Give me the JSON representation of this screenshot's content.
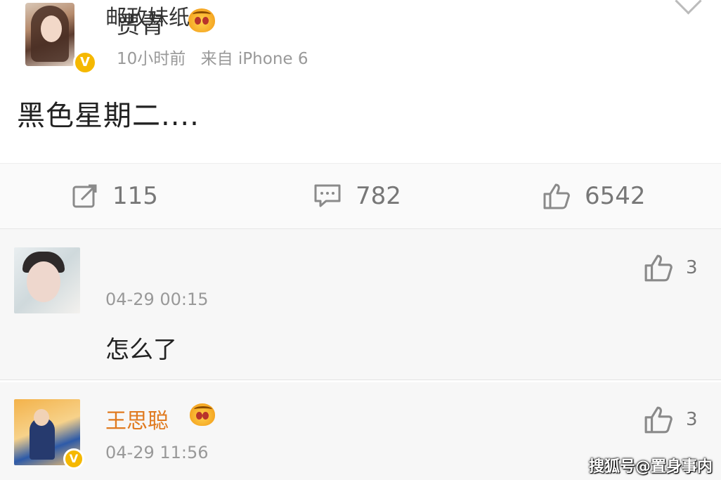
{
  "post": {
    "author": "贾青",
    "time": "10小时前",
    "source": "来自 iPhone 6",
    "verified_badge": "V",
    "content": "黑色星期二....",
    "icons": {
      "crown": "vip-crown-icon",
      "expand": "chevron-down-icon"
    }
  },
  "actions": {
    "repost_count": "115",
    "comment_count": "782",
    "like_count": "6542"
  },
  "comments": [
    {
      "name": "邮政妹纸",
      "time": "04-29 00:15",
      "text": "怎么了",
      "likes": "3"
    },
    {
      "name": "王思聪",
      "time": "04-29 11:56",
      "verified_badge": "V",
      "likes": "3"
    }
  ],
  "watermark": "搜狐号@置身事内",
  "colors": {
    "verified": "#f5b800",
    "vip_name": "#e07a1f",
    "muted": "#999999",
    "divider": "#e6e6e6"
  }
}
